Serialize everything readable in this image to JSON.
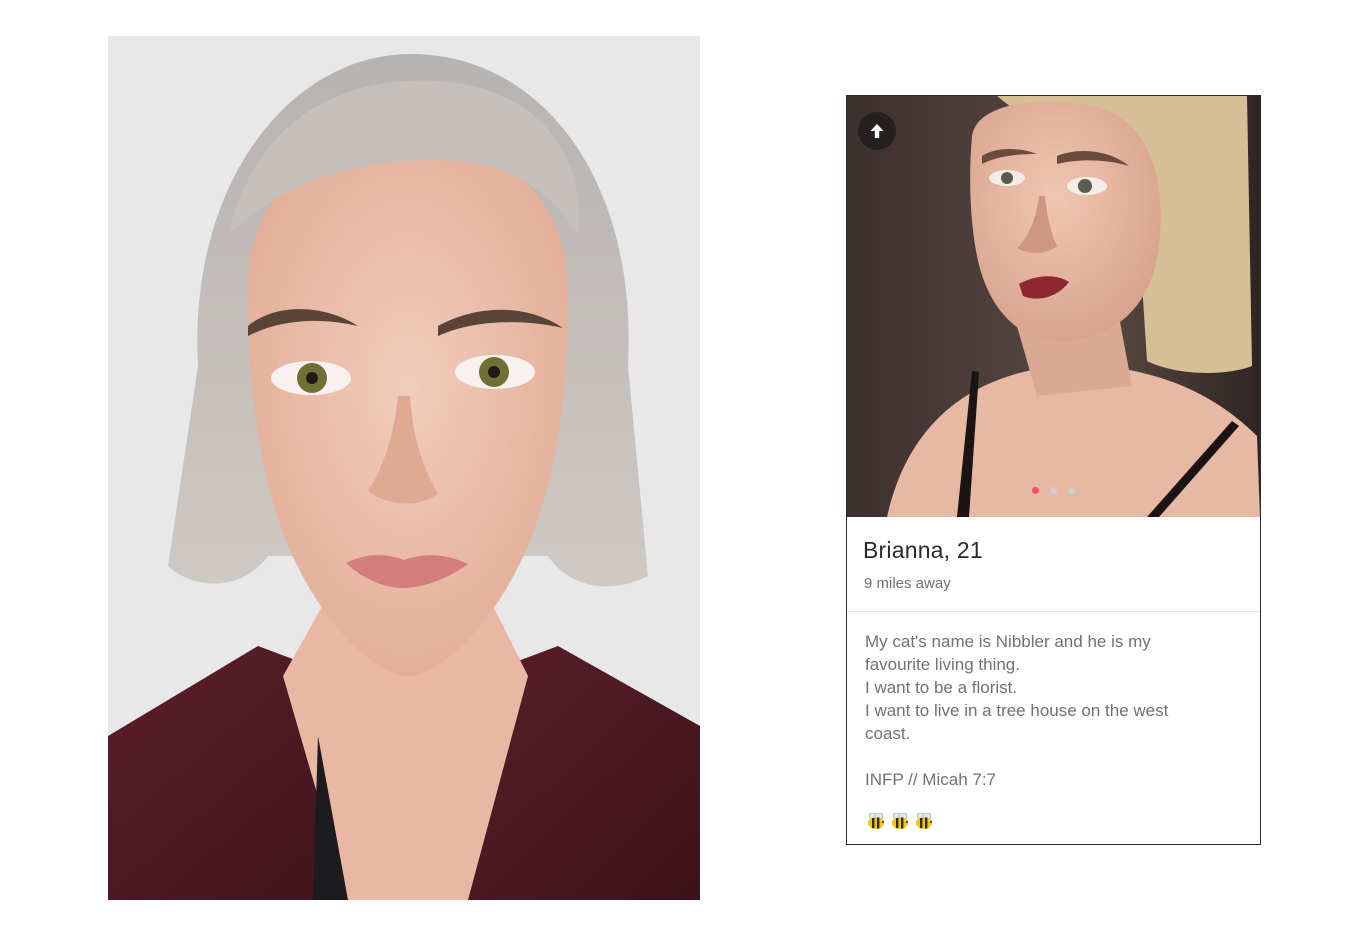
{
  "profile": {
    "name_age": "Brianna, 21",
    "distance": "9 miles away",
    "bio_lines": [
      "My cat's name is Nibbler and he is my",
      "favourite living thing.",
      "I want to be a florist.",
      "I want to live in a tree house on the west",
      "coast."
    ],
    "bio_tag": "INFP // Micah 7:7",
    "emoji": [
      "bee",
      "bee",
      "bee"
    ]
  },
  "carousel": {
    "count": 3,
    "active_index": 0
  },
  "icons": {
    "boost": "arrow-up-icon"
  },
  "colors": {
    "active_dot": "#f2506b",
    "inactive_dot": "#cfcfcf",
    "card_border": "#2b2b2b",
    "name_text": "#2a2a2a",
    "bio_text": "#717171"
  }
}
